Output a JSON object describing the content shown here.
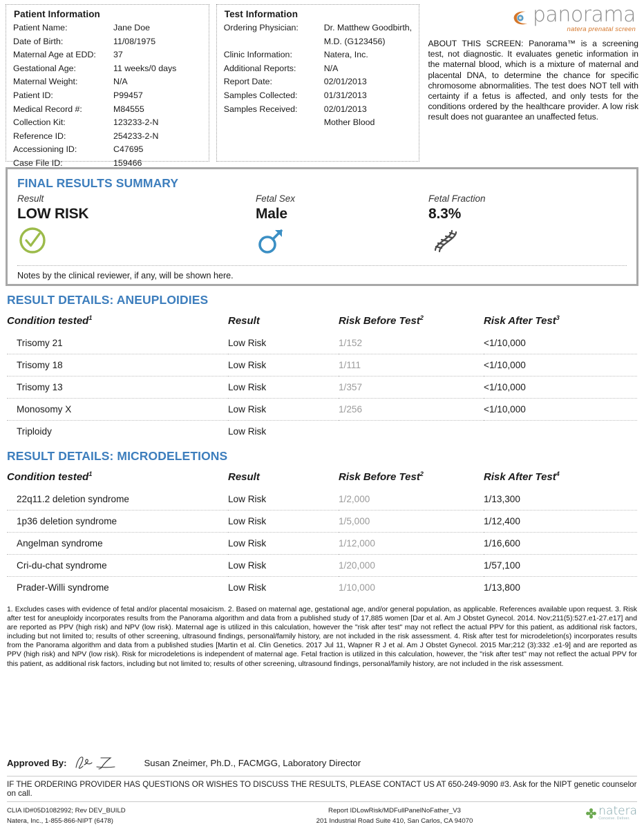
{
  "patient_panel": {
    "title": "Patient Information",
    "rows": [
      {
        "label": "Patient Name:",
        "value": "Jane Doe"
      },
      {
        "label": "Date of Birth:",
        "value": "11/08/1975"
      },
      {
        "label": "Maternal Age at EDD:",
        "value": "37"
      },
      {
        "label": "Gestational Age:",
        "value": "11 weeks/0 days"
      },
      {
        "label": "Maternal Weight:",
        "value": "N/A"
      },
      {
        "label": "Patient ID:",
        "value": "P99457"
      },
      {
        "label": "Medical Record #:",
        "value": "M84555"
      },
      {
        "label": "Collection Kit:",
        "value": "123233-2-N"
      },
      {
        "label": "Reference ID:",
        "value": "254233-2-N"
      },
      {
        "label": "Accessioning ID:",
        "value": "C47695"
      },
      {
        "label": "Case File ID:",
        "value": "159466"
      }
    ]
  },
  "test_panel": {
    "title": "Test Information",
    "rows": [
      {
        "label": "Ordering Physician:",
        "value": "Dr. Matthew Goodbirth,"
      },
      {
        "label": "",
        "value": "M.D. (G123456)"
      },
      {
        "label": "Clinic Information:",
        "value": "Natera, Inc."
      },
      {
        "label": "Additional Reports:",
        "value": "N/A"
      },
      {
        "label": "Report Date:",
        "value": "02/01/2013"
      },
      {
        "label": "Samples Collected:",
        "value": "01/31/2013"
      },
      {
        "label": "Samples Received:",
        "value": "02/01/2013"
      },
      {
        "label": "",
        "value": "Mother Blood"
      }
    ]
  },
  "logo": {
    "word": "panorama",
    "tagline": "natera prenatal screen",
    "swirl_color": "#d4762a",
    "word_color": "#8d8d8d"
  },
  "about": {
    "text": "ABOUT THIS SCREEN: Panorama™ is a screening test, not diagnostic. It evaluates genetic information in the maternal blood, which is a mixture of maternal and placental DNA, to determine the chance for specific chromosome abnormalities. The test does NOT tell with certainty if a fetus is affected, and only tests for the conditions ordered by the healthcare provider. A low risk result does not guarantee an unaffected fetus."
  },
  "summary": {
    "heading": "FINAL RESULTS SUMMARY",
    "heading_color": "#3d7ebd",
    "result_label": "Result",
    "result_value": "LOW RISK",
    "result_icon": "green-check-circle-icon",
    "result_icon_color": "#9cbb4a",
    "sex_label": "Fetal Sex",
    "sex_value": "Male",
    "sex_icon": "male-symbol-icon",
    "sex_icon_color": "#3b8fc4",
    "fraction_label": "Fetal Fraction",
    "fraction_value": "8.3%",
    "fraction_icon": "dna-helix-icon",
    "fraction_icon_color": "#4a4a4a",
    "notes": "Notes by the clinical reviewer, if any, will be shown here."
  },
  "aneuploidies": {
    "heading": "RESULT DETAILS: ANEUPLOIDIES",
    "columns": {
      "condition": "Condition tested",
      "condition_sup": "1",
      "result": "Result",
      "risk_before": "Risk Before Test",
      "risk_before_sup": "2",
      "risk_after": "Risk After Test",
      "risk_after_sup": "3"
    },
    "rows": [
      {
        "condition": "Trisomy 21",
        "result": "Low Risk",
        "risk_before": "1/152",
        "risk_after": "<1/10,000"
      },
      {
        "condition": "Trisomy 18",
        "result": "Low Risk",
        "risk_before": "1/111",
        "risk_after": "<1/10,000"
      },
      {
        "condition": "Trisomy 13",
        "result": "Low Risk",
        "risk_before": "1/357",
        "risk_after": "<1/10,000"
      },
      {
        "condition": "Monosomy X",
        "result": "Low Risk",
        "risk_before": "1/256",
        "risk_after": "<1/10,000"
      },
      {
        "condition": "Triploidy",
        "result": "Low Risk",
        "risk_before": "",
        "risk_after": ""
      }
    ]
  },
  "microdeletions": {
    "heading": "RESULT DETAILS: MICRODELETIONS",
    "columns": {
      "condition": "Condition tested",
      "condition_sup": "1",
      "result": "Result",
      "risk_before": "Risk Before Test",
      "risk_before_sup": "2",
      "risk_after": "Risk After Test",
      "risk_after_sup": "4"
    },
    "rows": [
      {
        "condition": "22q11.2 deletion syndrome",
        "result": "Low Risk",
        "risk_before": "1/2,000",
        "risk_after": "1/13,300"
      },
      {
        "condition": "1p36 deletion syndrome",
        "result": "Low Risk",
        "risk_before": "1/5,000",
        "risk_after": "1/12,400"
      },
      {
        "condition": "Angelman syndrome",
        "result": "Low Risk",
        "risk_before": "1/12,000",
        "risk_after": "1/16,600"
      },
      {
        "condition": "Cri-du-chat syndrome",
        "result": "Low Risk",
        "risk_before": "1/20,000",
        "risk_after": "1/57,100"
      },
      {
        "condition": "Prader-Willi syndrome",
        "result": "Low Risk",
        "risk_before": "1/10,000",
        "risk_after": "1/13,800"
      }
    ]
  },
  "footnotes": {
    "text": "1. Excludes cases with evidence of fetal and/or placental mosaicism.   2. Based on maternal age, gestational age, and/or general population, as applicable. References available upon request.   3. Risk after test for aneuploidy incorporates results from the Panorama algorithm and data from a published study of 17,885 women [Dar et al. Am J Obstet Gynecol. 2014. Nov;211(5):527.e1-27.e17] and are reported as PPV (high risk) and NPV (low risk). Maternal age is utilized in this calculation, however the \"risk after test\" may not reflect the actual PPV for this patient, as additional risk factors, including but not limited to; results of other screening, ultrasound findings, personal/family history, are not included in the risk assessment.   4. Risk after test for microdeletion(s) incorporates results from the Panorama algorithm and data from a published studies [Martin et al. Clin Genetics. 2017 Jul 11, Wapner R J et al. Am J Obstet Gynecol. 2015 Mar;212 (3):332 .e1-9] and are reported as PPV (high risk) and NPV (low risk). Risk for microdeletions is independent of maternal age. Fetal fraction is utilized in this calculation, however, the \"risk after test\" may not reflect the actual PPV for this patient, as additional risk factors, including but not limited to; results of other screening, ultrasound findings, personal/family history, are not included in the risk assessment."
  },
  "footer": {
    "approved_label": "Approved By:",
    "approver": "Susan Zneimer, Ph.D., FACMGG, Laboratory Director",
    "contact": "IF THE ORDERING PROVIDER HAS QUESTIONS OR WISHES TO DISCUSS THE RESULTS, PLEASE CONTACT US AT 650-249-9090 #3. Ask for the NIPT genetic counselor on call.",
    "clia": "CLIA ID#05D1082992; Rev DEV_BUILD",
    "company_phone": "Natera, Inc., 1-855-866-NIPT (6478)",
    "report_id": "Report IDLowRisk/MDFullPanelNoFather_V3",
    "address": "201 Industrial Road Suite 410, San Carlos, CA 94070",
    "logo_word": "natera",
    "logo_tag": "Conceive.  Deliver.",
    "logo_mark_color": "#6aa84f"
  }
}
